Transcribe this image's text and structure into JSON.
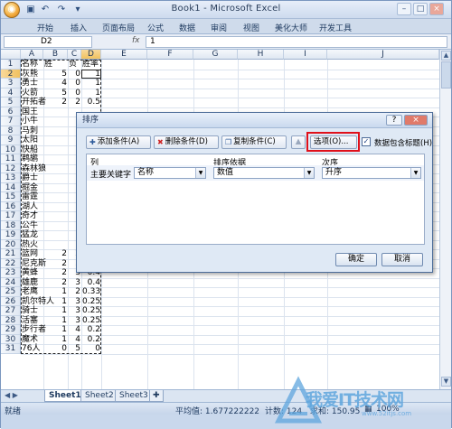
{
  "window": {
    "title": "Book1 - Microsoft Excel",
    "btn_min": "–",
    "btn_max": "□",
    "btn_close": "×"
  },
  "ribbon": {
    "tabs": [
      "开始",
      "插入",
      "页面布局",
      "公式",
      "数据",
      "审阅",
      "视图",
      "美化大师",
      "开发工具"
    ]
  },
  "formula_bar": {
    "name_box": "D2",
    "fx": "fx",
    "value": "1"
  },
  "sheet": {
    "columns": [
      "A",
      "B",
      "C",
      "D",
      "E",
      "F",
      "G",
      "H",
      "I",
      "J"
    ],
    "rows": [
      {
        "n": "1",
        "a": "名称",
        "b": "胜",
        "c": "负",
        "d": "胜率"
      },
      {
        "n": "2",
        "a": "灰熊",
        "b": "5",
        "c": "0",
        "d": "1"
      },
      {
        "n": "3",
        "a": "勇士",
        "b": "4",
        "c": "0",
        "d": "1"
      },
      {
        "n": "4",
        "a": "火箭",
        "b": "5",
        "c": "0",
        "d": "1"
      },
      {
        "n": "5",
        "a": "开拓者",
        "b": "2",
        "c": "2",
        "d": "0.5"
      },
      {
        "n": "6",
        "a": "国王",
        "b": "",
        "c": "",
        "d": ""
      },
      {
        "n": "7",
        "a": "小牛",
        "b": "",
        "c": "",
        "d": ""
      },
      {
        "n": "8",
        "a": "马刺",
        "b": "",
        "c": "",
        "d": ""
      },
      {
        "n": "9",
        "a": "太阳",
        "b": "",
        "c": "",
        "d": ""
      },
      {
        "n": "10",
        "a": "快船",
        "b": "",
        "c": "",
        "d": ""
      },
      {
        "n": "11",
        "a": "鹈鹕",
        "b": "",
        "c": "",
        "d": ""
      },
      {
        "n": "12",
        "a": "森林狼",
        "b": "",
        "c": "",
        "d": ""
      },
      {
        "n": "13",
        "a": "爵士",
        "b": "",
        "c": "",
        "d": ""
      },
      {
        "n": "14",
        "a": "掘金",
        "b": "",
        "c": "",
        "d": ""
      },
      {
        "n": "15",
        "a": "雷霆",
        "b": "",
        "c": "",
        "d": ""
      },
      {
        "n": "16",
        "a": "湖人",
        "b": "",
        "c": "",
        "d": ""
      },
      {
        "n": "17",
        "a": "奇才",
        "b": "",
        "c": "",
        "d": ""
      },
      {
        "n": "18",
        "a": "公牛",
        "b": "",
        "c": "",
        "d": ""
      },
      {
        "n": "19",
        "a": "猛龙",
        "b": "",
        "c": "",
        "d": ""
      },
      {
        "n": "20",
        "a": "热火",
        "b": "",
        "c": "",
        "d": ""
      },
      {
        "n": "21",
        "a": "篮网",
        "b": "2",
        "c": "2",
        "d": "0.5"
      },
      {
        "n": "22",
        "a": "尼克斯",
        "b": "2",
        "c": "3",
        "d": "0.4"
      },
      {
        "n": "23",
        "a": "黄蜂",
        "b": "2",
        "c": "3",
        "d": "0.4"
      },
      {
        "n": "24",
        "a": "雄鹿",
        "b": "2",
        "c": "3",
        "d": "0.4"
      },
      {
        "n": "25",
        "a": "老鹰",
        "b": "1",
        "c": "2",
        "d": "0.333"
      },
      {
        "n": "26",
        "a": "凯尔特人",
        "b": "1",
        "c": "3",
        "d": "0.25"
      },
      {
        "n": "27",
        "a": "骑士",
        "b": "1",
        "c": "3",
        "d": "0.25"
      },
      {
        "n": "28",
        "a": "活塞",
        "b": "1",
        "c": "3",
        "d": "0.25"
      },
      {
        "n": "29",
        "a": "步行者",
        "b": "1",
        "c": "4",
        "d": "0.2"
      },
      {
        "n": "30",
        "a": "魔术",
        "b": "1",
        "c": "4",
        "d": "0.2"
      },
      {
        "n": "31",
        "a": "76人",
        "b": "0",
        "c": "5",
        "d": "0"
      }
    ]
  },
  "sheet_tabs": [
    "Sheet1",
    "Sheet2",
    "Sheet3"
  ],
  "status": {
    "mode": "就绪",
    "average": "平均值: 1.677222222",
    "count": "计数: 124",
    "sum": "求和: 150.95",
    "zoom": "100%"
  },
  "dialog": {
    "title": "排序",
    "help": "?",
    "close": "×",
    "add_label": "添加条件(A)",
    "delete_label": "删除条件(D)",
    "copy_label": "复制条件(C)",
    "up_arrow": "▲",
    "down_arrow": "▼",
    "options_label": "选项(O)...",
    "has_header_label": "数据包含标题(H)",
    "has_header_checked": true,
    "col_header": "列",
    "basis_header": "排序依据",
    "order_header": "次序",
    "key_label": "主要关键字",
    "key_value": "名称",
    "basis_value": "数值",
    "order_value": "升序",
    "ok_label": "确定",
    "cancel_label": "取消"
  },
  "watermark": {
    "text": "我爱IT技术网",
    "sub": "www.52itjs.com"
  }
}
